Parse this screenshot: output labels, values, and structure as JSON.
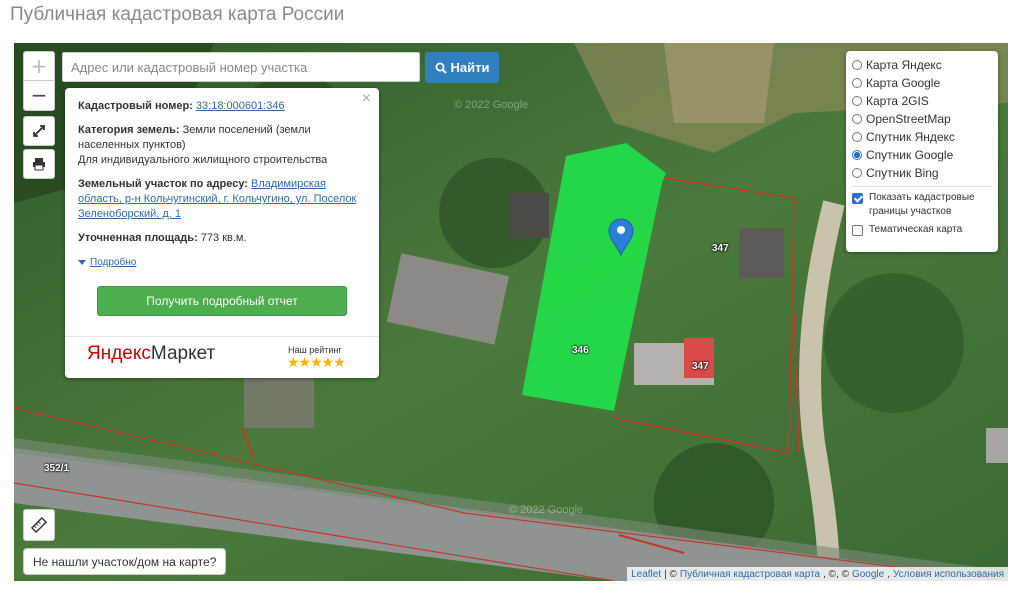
{
  "page": {
    "title": "Публичная кадастровая карта России"
  },
  "controls": {
    "zoom_in": "+",
    "zoom_out": "−",
    "fullscreen_icon": "expand-icon",
    "print_icon": "printer-icon",
    "ruler_icon": "ruler-icon"
  },
  "search": {
    "placeholder": "Адрес или кадастровый номер участка",
    "value": "",
    "button_label": "Найти"
  },
  "info": {
    "close": "×",
    "cadastral_label": "Кадастровый номер:",
    "cadastral_number": "33:18:000601:346",
    "category_label": "Категория земель:",
    "category_value": "Земли поселений (земли населенных пунктов)",
    "usage": "Для индивидуального жилищного строительства",
    "address_label": "Земельный участок по адресу:",
    "address_value": "Владимирская область, р-н Кольчугинский, г. Кольчугино, ул. Поселок Зеленоборский, д. 1",
    "area_label": "Уточненная площадь:",
    "area_value": "773 кв.м.",
    "more_link": "Подробно",
    "report_button": "Получить подробный отчет",
    "ad": {
      "brand_y": "Яндекс",
      "brand_rest": "Маркет",
      "rating_label": "Наш рейтинг",
      "stars": "★★★★★",
      "rating": 5
    }
  },
  "layers": {
    "base": [
      {
        "label": "Карта Яндекс",
        "selected": false
      },
      {
        "label": "Карта Google",
        "selected": false
      },
      {
        "label": "Карта 2GIS",
        "selected": false
      },
      {
        "label": "OpenStreetMap",
        "selected": false
      },
      {
        "label": "Спутник Яндекс",
        "selected": false
      },
      {
        "label": "Спутник Google",
        "selected": true
      },
      {
        "label": "Спутник Bing",
        "selected": false
      }
    ],
    "overlays": [
      {
        "label": "Показать кадастровые границы участков",
        "checked": true
      },
      {
        "label": "Тематическая карта",
        "checked": false
      }
    ]
  },
  "map": {
    "parcel_labels": [
      "346",
      "347",
      "347",
      "352/1"
    ],
    "selected_parcel_color": "#22e04a",
    "boundary_color": "#c0392b",
    "imagery_watermark": "© 2022 Google"
  },
  "not_found_button": "Не нашли участок/дом на карте?",
  "attribution": {
    "leaflet": "Leaflet",
    "sep1": "| ©",
    "pkk": "Публичная кадастровая карта",
    "sep2": ", ©, ©",
    "google": "Google",
    "sep3": ",",
    "terms": "Условия использования"
  }
}
